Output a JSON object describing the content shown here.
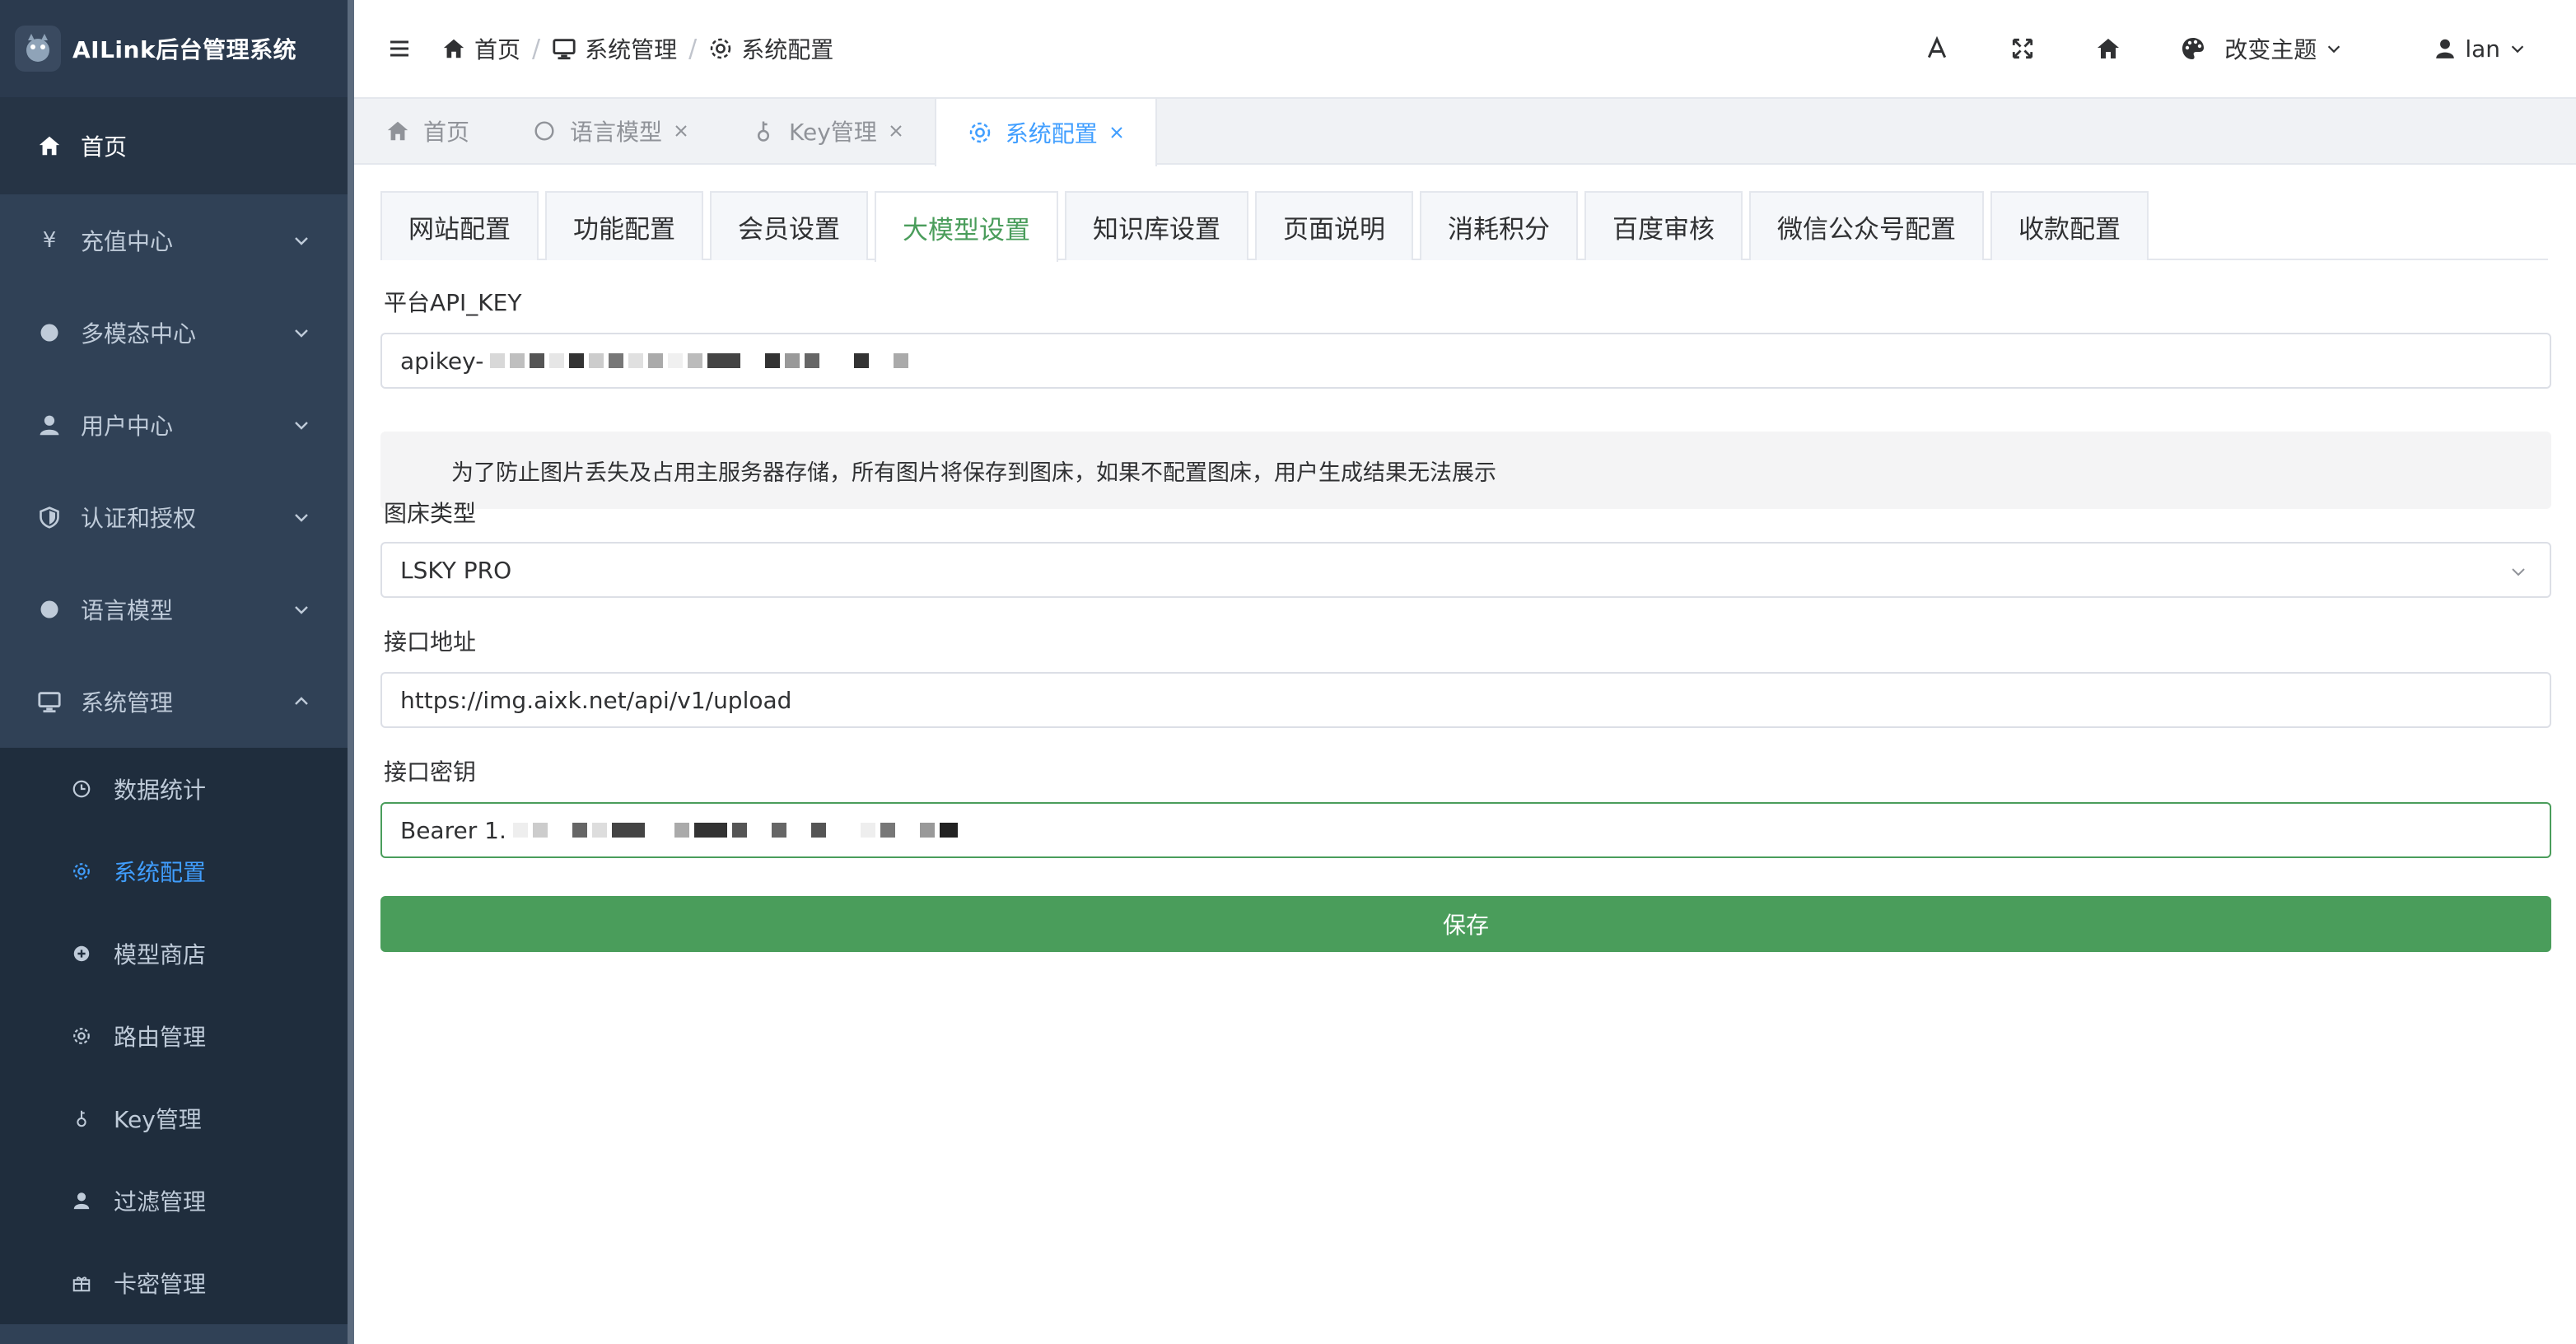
{
  "app": {
    "title": "AILink后台管理系统"
  },
  "sidebar": {
    "items": [
      {
        "label": "首页",
        "icon": "home-icon"
      },
      {
        "label": "充值中心",
        "icon": "yen-icon"
      },
      {
        "label": "多模态中心",
        "icon": "circle-icon"
      },
      {
        "label": "用户中心",
        "icon": "user-icon"
      },
      {
        "label": "认证和授权",
        "icon": "shield-icon"
      },
      {
        "label": "语言模型",
        "icon": "circle-icon"
      },
      {
        "label": "系统管理",
        "icon": "monitor-icon"
      }
    ],
    "sub_items": [
      {
        "label": "数据统计",
        "icon": "clock-icon"
      },
      {
        "label": "系统配置",
        "icon": "gear-icon"
      },
      {
        "label": "模型商店",
        "icon": "plus-circle-icon"
      },
      {
        "label": "路由管理",
        "icon": "gear-icon"
      },
      {
        "label": "Key管理",
        "icon": "key-icon"
      },
      {
        "label": "过滤管理",
        "icon": "user-icon"
      },
      {
        "label": "卡密管理",
        "icon": "gift-icon"
      }
    ]
  },
  "header": {
    "breadcrumb": [
      "首页",
      "系统管理",
      "系统配置"
    ],
    "separator": "/",
    "theme_label": "改变主题",
    "user_label": "lan"
  },
  "tags": [
    {
      "label": "首页"
    },
    {
      "label": "语言模型"
    },
    {
      "label": "Key管理"
    },
    {
      "label": "系统配置"
    }
  ],
  "config_tabs": [
    "网站配置",
    "功能配置",
    "会员设置",
    "大模型设置",
    "知识库设置",
    "页面说明",
    "消耗积分",
    "百度审核",
    "微信公众号配置",
    "收款配置"
  ],
  "form": {
    "api_key_label": "平台API_KEY",
    "api_key_value": "apikey-",
    "notice": "为了防止图片丢失及占用主服务器存储，所有图片将保存到图床，如果不配置图床，用户生成结果无法展示",
    "bed_type_label": "图床类型",
    "bed_type_value": "LSKY PRO",
    "endpoint_label": "接口地址",
    "endpoint_value": "https://img.aixk.net/api/v1/upload",
    "secret_label": "接口密钥",
    "secret_value": "Bearer 1.",
    "save_label": "保存"
  },
  "colors": {
    "sidebar_bg": "#304156",
    "active_blue": "#409eff",
    "primary_green": "#4a9d5b"
  }
}
